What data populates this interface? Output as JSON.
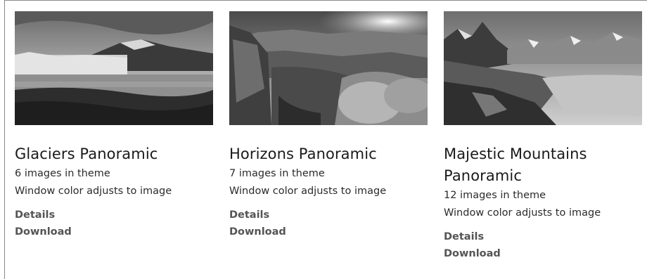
{
  "themes": [
    {
      "image_name": "glaciers-image",
      "title": "Glaciers Panoramic",
      "count": "6 images in theme",
      "note": "Window color adjusts to image",
      "details": "Details",
      "download": "Download"
    },
    {
      "image_name": "horizons-image",
      "title": "Horizons Panoramic",
      "count": "7 images in theme",
      "note": "Window color adjusts to image",
      "details": "Details",
      "download": "Download"
    },
    {
      "image_name": "mountains-image",
      "title": "Majestic Mountains Panoramic",
      "count": "12 images in theme",
      "note": "Window color adjusts to image",
      "details": "Details",
      "download": "Download"
    }
  ]
}
